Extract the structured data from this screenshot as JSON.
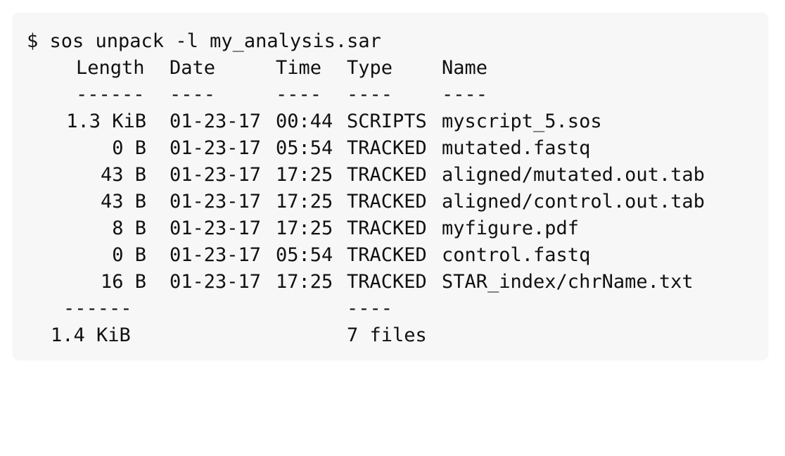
{
  "command": "$ sos unpack -l my_analysis.sar",
  "header": {
    "length": "Length",
    "date": "Date",
    "time": "Time",
    "type": "Type",
    "name": "Name"
  },
  "header_rule": {
    "length": "------",
    "date": "----",
    "time": "----",
    "type": "----",
    "name": "----"
  },
  "rows": [
    {
      "length": "1.3 KiB",
      "date": "01-23-17",
      "time": "00:44",
      "type": "SCRIPTS",
      "name": "myscript_5.sos"
    },
    {
      "length": "0 B",
      "date": "01-23-17",
      "time": "05:54",
      "type": "TRACKED",
      "name": "mutated.fastq"
    },
    {
      "length": "43 B",
      "date": "01-23-17",
      "time": "17:25",
      "type": "TRACKED",
      "name": "aligned/mutated.out.tab"
    },
    {
      "length": "43 B",
      "date": "01-23-17",
      "time": "17:25",
      "type": "TRACKED",
      "name": "aligned/control.out.tab"
    },
    {
      "length": "8 B",
      "date": "01-23-17",
      "time": "17:25",
      "type": "TRACKED",
      "name": "myfigure.pdf"
    },
    {
      "length": "0 B",
      "date": "01-23-17",
      "time": "05:54",
      "type": "TRACKED",
      "name": "control.fastq"
    },
    {
      "length": "16 B",
      "date": "01-23-17",
      "time": "17:25",
      "type": "TRACKED",
      "name": "STAR_index/chrName.txt"
    }
  ],
  "footer_rule": {
    "length": "------",
    "type": "----"
  },
  "footer": {
    "total_size": "1.4 KiB",
    "file_count": "7 files"
  }
}
